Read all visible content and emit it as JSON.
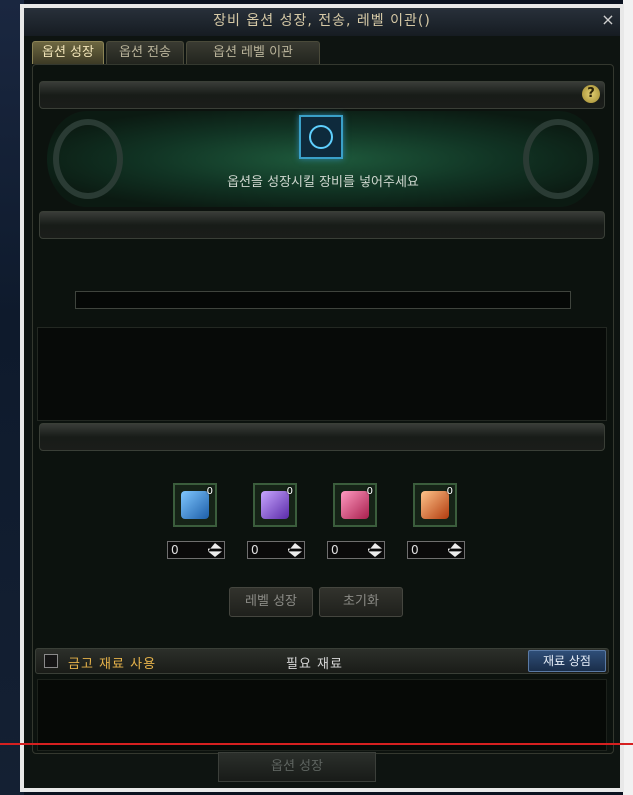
{
  "window": {
    "title": "장비 옵션 성장, 전송, 레벨 이관()",
    "close_label": "×"
  },
  "tabs": [
    {
      "label": "옵션 성장",
      "active": true
    },
    {
      "label": "옵션 전송",
      "active": false
    },
    {
      "label": "옵션 레벨 이관",
      "active": false
    }
  ],
  "panel": {
    "help_label": "?",
    "hero_text": "옵션을 성장시킬 장비를 넣어주세요"
  },
  "materials": [
    {
      "icon": "blue-gem-icon",
      "count": "0",
      "quantity": "0",
      "color": "#3a8ed6"
    },
    {
      "icon": "purple-gem-icon",
      "count": "0",
      "quantity": "0",
      "color": "#8a4fd6"
    },
    {
      "icon": "pink-gem-icon",
      "count": "0",
      "quantity": "0",
      "color": "#d63a6b"
    },
    {
      "icon": "orange-gem-icon",
      "count": "0",
      "quantity": "0",
      "color": "#e0621f"
    }
  ],
  "buttons": {
    "level_growth": "레벨 성장",
    "reset": "초기화",
    "footer": "옵션 성장"
  },
  "bottom_bar": {
    "checkbox_label": "금고 재료 사용",
    "required_label": "필요 재료",
    "shop_button": "재료 상점"
  },
  "colors": {
    "accent_gold": "#e5b24a",
    "active_tab": "#6d6741",
    "shop_blue": "#2f4e78",
    "red_line": "#d62020"
  }
}
